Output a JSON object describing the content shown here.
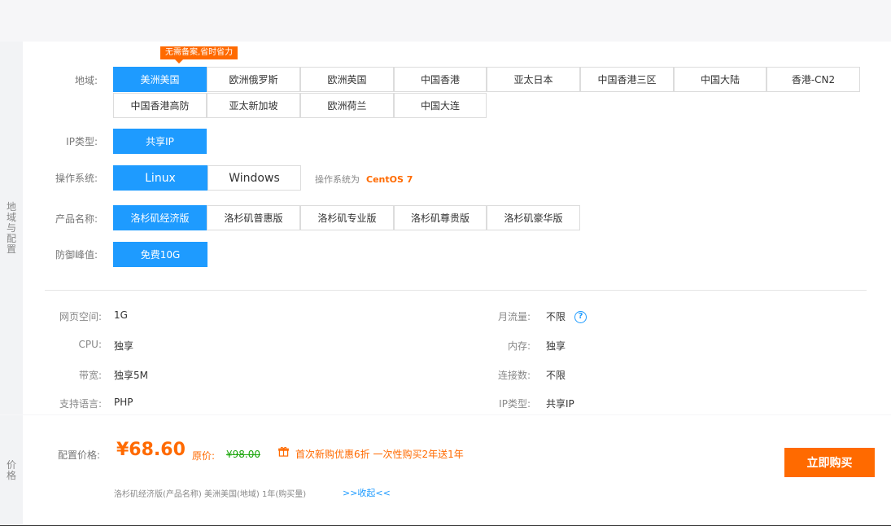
{
  "config": {
    "side_label": "地域与配置",
    "promo_badge": "无需备案,省时省力",
    "region": {
      "label": "地域:",
      "options": [
        "美洲美国",
        "欧洲俄罗斯",
        "欧洲英国",
        "中国香港",
        "亚太日本",
        "中国香港三区",
        "中国大陆",
        "香港-CN2",
        "中国香港高防",
        "亚太新加坡",
        "欧洲荷兰",
        "中国大连"
      ],
      "selected": "美洲美国"
    },
    "ip_type": {
      "label": "IP类型:",
      "options": [
        "共享IP"
      ],
      "selected": "共享IP"
    },
    "os": {
      "label": "操作系统:",
      "options": [
        "Linux",
        "Windows"
      ],
      "selected": "Linux",
      "note_prefix": "操作系统为",
      "note_value": "CentOS 7"
    },
    "product": {
      "label": "产品名称:",
      "options": [
        "洛杉矶经济版",
        "洛杉矶普惠版",
        "洛杉矶专业版",
        "洛杉矶尊贵版",
        "洛杉矶豪华版"
      ],
      "selected": "洛杉矶经济版"
    },
    "defense": {
      "label": "防御峰值:",
      "options": [
        "免费10G"
      ],
      "selected": "免费10G"
    },
    "specs": {
      "web_space": {
        "label": "网页空间:",
        "value": "1G"
      },
      "cpu": {
        "label": "CPU:",
        "value": "独享"
      },
      "bandwidth": {
        "label": "带宽:",
        "value": "独享5M"
      },
      "language": {
        "label": "支持语言:",
        "value": "PHP"
      },
      "traffic": {
        "label": "月流量:",
        "value": "不限"
      },
      "memory": {
        "label": "内存:",
        "value": "独享"
      },
      "connections": {
        "label": "连接数:",
        "value": "不限"
      },
      "ip_type": {
        "label": "IP类型:",
        "value": "共享IP"
      }
    }
  },
  "price": {
    "side_label": "价格",
    "label": "配置价格:",
    "current": "¥68.60",
    "original_label": "原价:",
    "original": "¥98.00",
    "promo": "首次新购优惠6折 一次性购买2年送1年",
    "summary": "洛杉矶经济版(产品名称) 美洲美国(地域) 1年(购买量)",
    "collapse": ">>收起<<",
    "buy_button": "立即购买"
  },
  "colors": {
    "primary": "#1e9bff",
    "accent": "#ff6a00",
    "green": "#1aa60a"
  },
  "icons": {
    "help": "help-circle-icon",
    "gift": "gift-icon"
  }
}
